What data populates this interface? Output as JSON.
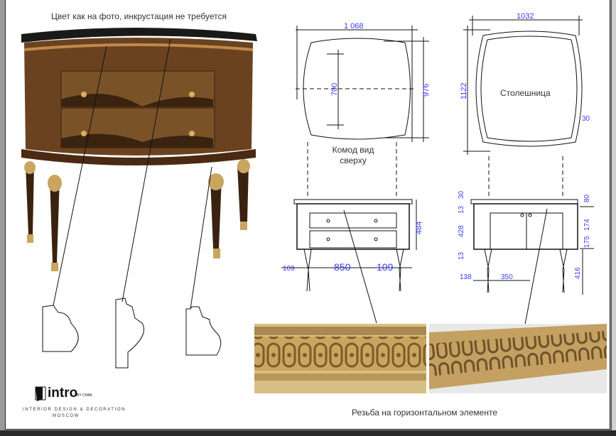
{
  "captions": {
    "photo_note": "Цвет как на фото, инкрустация не требуется",
    "top_view": "Комод вид сверху",
    "tabletop": "Столешница",
    "carving": "Резьба на горизонтальном элементе"
  },
  "dimensions": {
    "left_top": {
      "width": "1 068",
      "depth": "976",
      "inner": "700"
    },
    "right_top": {
      "width": "1032",
      "depth": "1122",
      "edge": "30"
    },
    "left_front": {
      "height": "484",
      "left": "109",
      "mid": "850",
      "right": "109"
    },
    "right_front": {
      "d30": "30",
      "d13a": "13",
      "d428": "428",
      "d13b": "13",
      "d138": "138",
      "d350": "350",
      "d80": "80",
      "d174": "174",
      "d175": "175",
      "d416": "416"
    }
  },
  "logo": {
    "brand": "intro",
    "by": "BY CHAK",
    "tagline": "INTERIOR DESIGN & DECORATION",
    "city": "MOSCOW"
  },
  "colors": {
    "wood": "#5a3518",
    "gold": "#c9a560",
    "dim": "#3b3bff"
  }
}
